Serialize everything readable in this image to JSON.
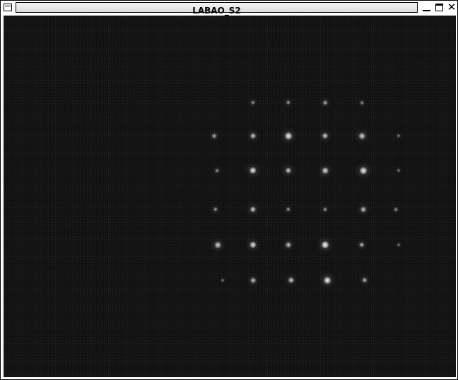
{
  "window": {
    "title": "LABAO_S2"
  },
  "titlebar_buttons": {
    "menu_icon": "window-menu-icon",
    "minimize_icon": "minimize-icon",
    "maximize_icon": "maximize-icon",
    "close_icon": "close-icon",
    "close_glyph": "✕"
  },
  "image_view": {
    "background_color": "#101010",
    "spot_color": "#ffffff",
    "grid_rows": 6,
    "grid_cols": 6
  }
}
